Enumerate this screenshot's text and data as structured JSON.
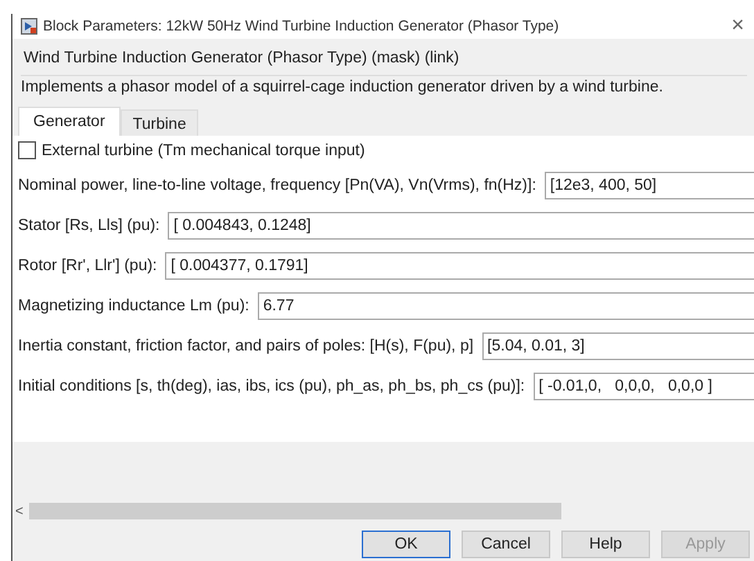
{
  "window": {
    "title": "Block Parameters: 12kW 50Hz Wind Turbine Induction Generator (Phasor Type)",
    "close": "×"
  },
  "header": {
    "title": "Wind Turbine Induction Generator (Phasor Type) (mask) (link)",
    "description": "Implements a phasor model of a squirrel-cage induction generator driven by a wind turbine."
  },
  "tabs": [
    {
      "label": "Generator",
      "selected": true
    },
    {
      "label": "Turbine",
      "selected": false
    }
  ],
  "checkbox": {
    "label": "External turbine (Tm mechanical torque input)",
    "checked": false
  },
  "parameters": [
    {
      "label": "Nominal power, line-to-line voltage, frequency [Pn(VA), Vn(Vrms), fn(Hz)]:",
      "value": "[12e3, 400, 50]"
    },
    {
      "label": "Stator [Rs, Lls] (pu):",
      "value": "[ 0.004843, 0.1248]"
    },
    {
      "label": "Rotor [Rr', Llr'] (pu):",
      "value": "[ 0.004377, 0.1791]"
    },
    {
      "label": "Magnetizing inductance Lm (pu):",
      "value": "6.77"
    },
    {
      "label": "Inertia constant, friction factor, and pairs of poles: [H(s), F(pu), p]",
      "value": "[5.04, 0.01, 3]"
    },
    {
      "label": "Initial conditions [s, th(deg), ias, ibs, ics (pu), ph_as, ph_bs, ph_cs (pu)]:",
      "value": "[ -0.01,0,   0,0,0,   0,0,0 ]"
    }
  ],
  "scrollbar": {
    "left": "<"
  },
  "buttons": [
    {
      "label": "OK",
      "disabled": false,
      "selected": true
    },
    {
      "label": "Cancel",
      "disabled": false,
      "selected": false
    },
    {
      "label": "Help",
      "disabled": false,
      "selected": false
    },
    {
      "label": "Apply",
      "disabled": true,
      "selected": false
    }
  ]
}
